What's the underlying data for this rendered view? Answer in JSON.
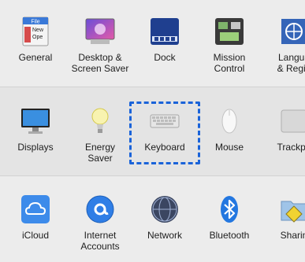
{
  "rows": [
    [
      {
        "id": "general",
        "label": "General",
        "icon": "general-icon"
      },
      {
        "id": "desktop",
        "label": "Desktop &\nScreen Saver",
        "icon": "desktop-screensaver-icon"
      },
      {
        "id": "dock",
        "label": "Dock",
        "icon": "dock-icon"
      },
      {
        "id": "mission",
        "label": "Mission\nControl",
        "icon": "mission-control-icon"
      },
      {
        "id": "language",
        "label": "Langua\n& Regio",
        "icon": "language-region-icon"
      }
    ],
    [
      {
        "id": "displays",
        "label": "Displays",
        "icon": "displays-icon"
      },
      {
        "id": "energy",
        "label": "Energy\nSaver",
        "icon": "energy-saver-icon"
      },
      {
        "id": "keyboard",
        "label": "Keyboard",
        "icon": "keyboard-icon"
      },
      {
        "id": "mouse",
        "label": "Mouse",
        "icon": "mouse-icon"
      },
      {
        "id": "trackpad",
        "label": "Trackpa",
        "icon": "trackpad-icon"
      }
    ],
    [
      {
        "id": "icloud",
        "label": "iCloud",
        "icon": "icloud-icon"
      },
      {
        "id": "internet",
        "label": "Internet\nAccounts",
        "icon": "internet-accounts-icon"
      },
      {
        "id": "network",
        "label": "Network",
        "icon": "network-icon"
      },
      {
        "id": "bluetooth",
        "label": "Bluetooth",
        "icon": "bluetooth-icon"
      },
      {
        "id": "sharing",
        "label": "Sharin",
        "icon": "sharing-icon"
      }
    ]
  ],
  "general_file_text": "File",
  "general_new_text": "New",
  "general_ope_text": "Ope",
  "selected": "Keyboard",
  "colors": {
    "focus_ring": "#1a63d9",
    "background": "#ececec"
  }
}
